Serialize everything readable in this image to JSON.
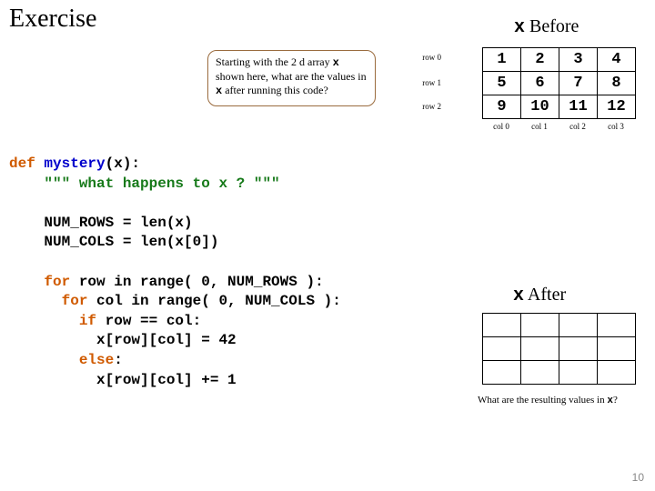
{
  "title": "Exercise",
  "question": {
    "line1_a": "Starting with the 2 d array ",
    "line1_code": "x",
    "line2": " shown here, what are the values in ",
    "line3_code": "x",
    "line3_b": " after running this code?"
  },
  "before": {
    "label_code": "x",
    "label_text": " Before",
    "row_labels": [
      "row 0",
      "row 1",
      "row 2"
    ],
    "col_labels": [
      "col 0",
      "col 1",
      "col 2",
      "col 3"
    ],
    "rows": [
      [
        "1",
        "2",
        "3",
        "4"
      ],
      [
        "5",
        "6",
        "7",
        "8"
      ],
      [
        "9",
        "10",
        "11",
        "12"
      ]
    ]
  },
  "code": {
    "l1_kw": "def ",
    "l1_fn": "mystery",
    "l1_rest": "(x):",
    "l2_pad": "    ",
    "l2_str": "\"\"\" what happens to x ? \"\"\"",
    "l3": "",
    "l4": "    NUM_ROWS = len(x)",
    "l5": "    NUM_COLS = len(x[0])",
    "l6": "",
    "l7_pad": "    ",
    "l7_kw": "for",
    "l7_rest": " row in range( 0, NUM_ROWS ):",
    "l8_pad": "      ",
    "l8_kw": "for",
    "l8_rest": " col in range( 0, NUM_COLS ):",
    "l9_pad": "        ",
    "l9_kw": "if",
    "l9_rest": " row == col:",
    "l10": "          x[row][col] = 42",
    "l11_pad": "        ",
    "l11_kw": "else",
    "l11_rest": ":",
    "l12": "          x[row][col] += 1"
  },
  "after": {
    "label_code": "x",
    "label_text": " After",
    "caption_a": "What are the resulting values in ",
    "caption_code": "x",
    "caption_b": "?",
    "rows": [
      [
        "",
        "",
        "",
        ""
      ],
      [
        "",
        "",
        "",
        ""
      ],
      [
        "",
        "",
        "",
        ""
      ]
    ]
  },
  "page_number": "10",
  "chart_data": {
    "type": "table",
    "title": "x Before",
    "columns": [
      "col 0",
      "col 1",
      "col 2",
      "col 3"
    ],
    "rows": [
      "row 0",
      "row 1",
      "row 2"
    ],
    "values": [
      [
        1,
        2,
        3,
        4
      ],
      [
        5,
        6,
        7,
        8
      ],
      [
        9,
        10,
        11,
        12
      ]
    ]
  }
}
